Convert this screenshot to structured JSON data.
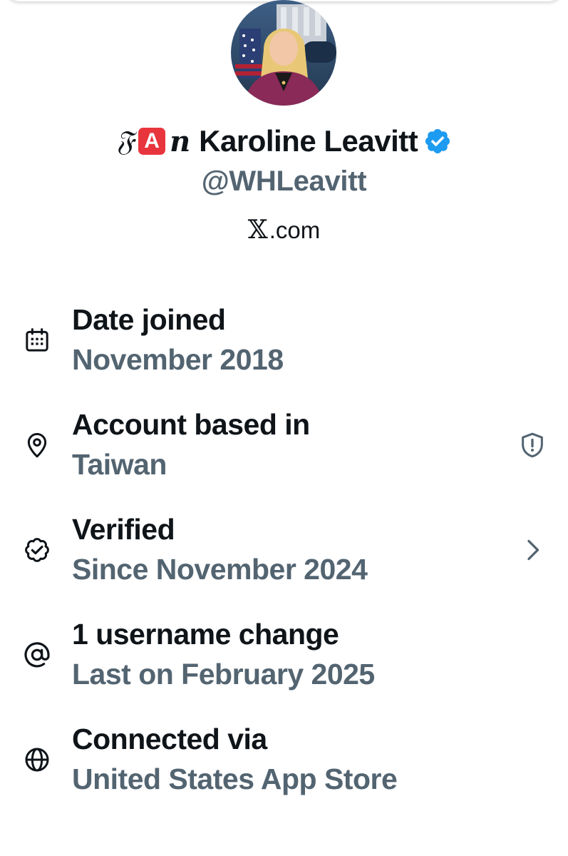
{
  "profile": {
    "display_name_prefix_letter": "𝔉",
    "display_name_emoji": "A",
    "display_name_italic": "n",
    "display_name": "Karoline Leavitt",
    "handle": "@WHLeavitt",
    "platform_mark": "𝕏",
    "platform_suffix": ".com",
    "verified": true,
    "verified_color": "#1d9bf0"
  },
  "about": [
    {
      "icon": "calendar-icon",
      "title": "Date joined",
      "value": "November 2018"
    },
    {
      "icon": "location-pin-icon",
      "title": "Account based in",
      "value": "Taiwan",
      "trailing_icon": "shield-alert-icon"
    },
    {
      "icon": "verified-outline-icon",
      "title": "Verified",
      "value": "Since November 2024",
      "trailing_icon": "chevron-right-icon"
    },
    {
      "icon": "at-sign-icon",
      "title": "1 username change",
      "value": "Last on February 2025"
    },
    {
      "icon": "globe-icon",
      "title": "Connected via",
      "value": "United States App Store"
    }
  ],
  "colors": {
    "primary_text": "#0f1419",
    "secondary_text": "#536471",
    "accent": "#1d9bf0",
    "emoji_red": "#e8353d"
  }
}
